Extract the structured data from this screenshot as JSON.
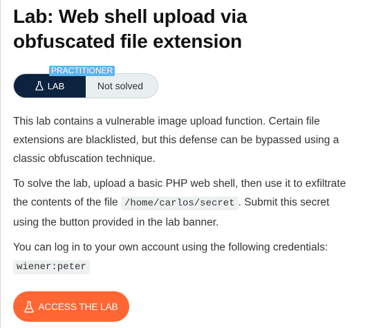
{
  "lab": {
    "title_line1": "Lab: Web shell upload via",
    "title_line2": "obfuscated file extension",
    "level": "PRACTITIONER",
    "lab_tag": "LAB",
    "status": "Not solved"
  },
  "content": {
    "p1": "This lab contains a vulnerable image upload function. Certain file extensions are blacklisted, but this defense can be bypassed using a classic obfuscation technique.",
    "p2_before": "To solve the lab, upload a basic PHP web shell, then use it to exfiltrate the contents of the file ",
    "p2_code": "/home/carlos/secret",
    "p2_after": ". Submit this secret using the button provided in the lab banner.",
    "p3_before": "You can log in to your own account using the following credentials: ",
    "p3_code": "wiener:peter"
  },
  "access_button": {
    "label": "ACCESS THE LAB"
  },
  "colors": {
    "lab_tag_bg": "#0c2340",
    "level_badge_bg": "#5bb5f0",
    "access_button_bg": "#ff6633"
  },
  "icons": {
    "lab_tag": "flask-icon",
    "access_button": "flask-icon"
  }
}
